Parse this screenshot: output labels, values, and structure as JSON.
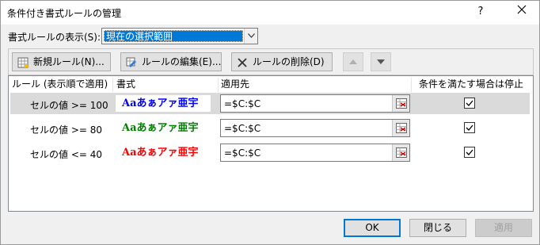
{
  "window": {
    "title": "条件付き書式ルールの管理",
    "help": "?"
  },
  "show": {
    "label": "書式ルールの表示(S):",
    "selected": "現在の選択範囲"
  },
  "toolbar": {
    "new_rule": "新規ルール(N)...",
    "edit_rule": "ルールの編集(E)...",
    "delete_rule": "ルールの削除(D)"
  },
  "columns": {
    "rule": "ルール (表示順で適用)",
    "format": "書式",
    "applies_to": "適用先",
    "stop_if_true": "条件を満たす場合は停止"
  },
  "rules": [
    {
      "name": "セルの値 >= 100",
      "preview": "Aaあぁアァ亜宇",
      "preview_color": "#0000ff",
      "applies_to": "=$C:$C",
      "stop": true,
      "selected": true
    },
    {
      "name": "セルの値 >= 80",
      "preview": "Aaあぁアァ亜宇",
      "preview_color": "#008000",
      "applies_to": "=$C:$C",
      "stop": true,
      "selected": false
    },
    {
      "name": "セルの値 <= 40",
      "preview": "Aaあぁアァ亜宇",
      "preview_color": "#ff0000",
      "applies_to": "=$C:$C",
      "stop": true,
      "selected": false
    }
  ],
  "buttons": {
    "ok": "OK",
    "close": "閉じる",
    "apply": "適用"
  },
  "colors": {
    "accent": "#0078d7",
    "selection": "#dadada"
  }
}
